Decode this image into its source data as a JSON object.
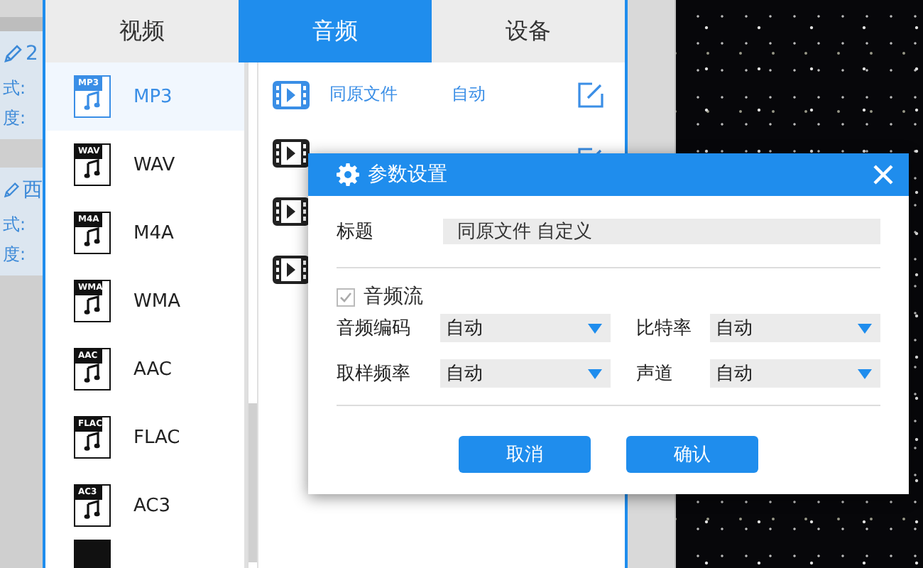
{
  "side_cards": [
    {
      "title": "2",
      "lines": [
        "式:",
        "度:"
      ]
    },
    {
      "title": "西",
      "lines": [
        "式:",
        "度:"
      ]
    }
  ],
  "tabs": [
    {
      "label": "视频",
      "selected": false
    },
    {
      "label": "音频",
      "selected": true
    },
    {
      "label": "设备",
      "selected": false
    }
  ],
  "formats": [
    {
      "label": "MP3",
      "badge": "MP3",
      "selected": true
    },
    {
      "label": "WAV",
      "badge": "WAV",
      "selected": false
    },
    {
      "label": "M4A",
      "badge": "M4A",
      "selected": false
    },
    {
      "label": "WMA",
      "badge": "WMA",
      "selected": false
    },
    {
      "label": "AAC",
      "badge": "AAC",
      "selected": false
    },
    {
      "label": "FLAC",
      "badge": "FLAC",
      "selected": false
    },
    {
      "label": "AC3",
      "badge": "AC3",
      "selected": false
    }
  ],
  "presets": [
    {
      "name": "同原文件",
      "value": "自动",
      "selected": true
    },
    {
      "selected": false
    },
    {
      "selected": false
    },
    {
      "selected": false
    }
  ],
  "dialog": {
    "title": "参数设置",
    "title_label": "标题",
    "title_value": "同原文件 自定义",
    "audio_stream": {
      "label": "音频流",
      "checked": true,
      "disabled": true
    },
    "fields": [
      {
        "label": "音频编码",
        "value": "自动"
      },
      {
        "label": "比特率",
        "value": "自动"
      },
      {
        "label": "取样频率",
        "value": "自动"
      },
      {
        "label": "声道",
        "value": "自动"
      }
    ],
    "buttons": [
      "取消",
      "确认"
    ]
  }
}
